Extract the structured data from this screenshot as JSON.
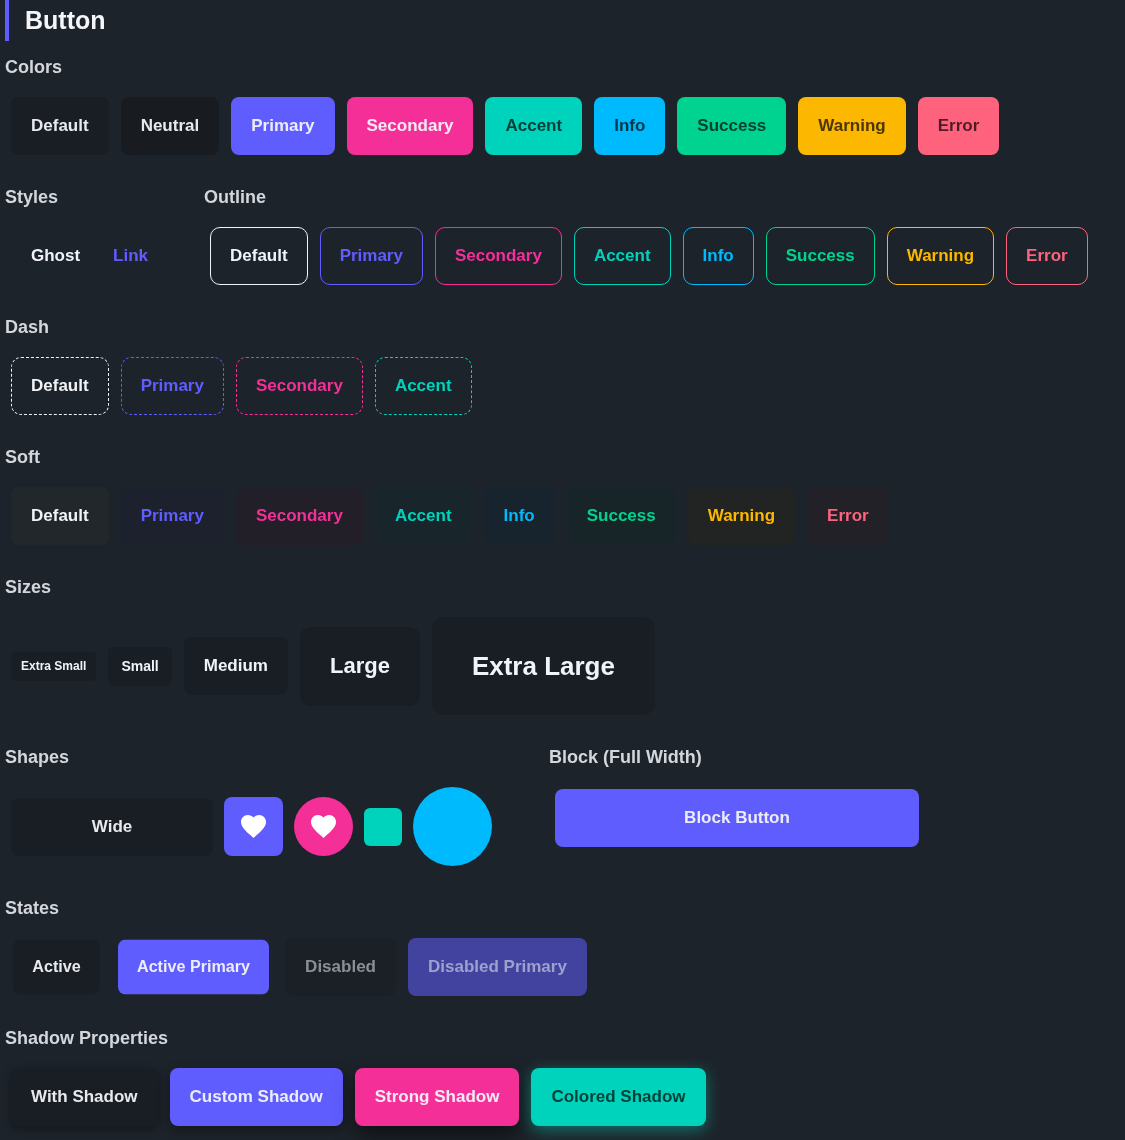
{
  "title": "Button",
  "colors": {
    "heading": "Colors",
    "buttons": [
      {
        "label": "Default",
        "color": "#191e24"
      },
      {
        "label": "Neutral",
        "color": "#181b20"
      },
      {
        "label": "Primary",
        "color": "#605dff"
      },
      {
        "label": "Secondary",
        "color": "#f43098"
      },
      {
        "label": "Accent",
        "color": "#00d3bb"
      },
      {
        "label": "Info",
        "color": "#00bafe"
      },
      {
        "label": "Success",
        "color": "#00d390"
      },
      {
        "label": "Warning",
        "color": "#fcb700"
      },
      {
        "label": "Error",
        "color": "#ff627d"
      }
    ]
  },
  "styles": {
    "heading": "Styles",
    "buttons": [
      {
        "label": "Ghost",
        "kind": "ghost"
      },
      {
        "label": "Link",
        "kind": "link"
      }
    ]
  },
  "outline": {
    "heading": "Outline",
    "buttons": [
      {
        "label": "Default",
        "color": "#f0f3f7"
      },
      {
        "label": "Primary",
        "color": "#605dff"
      },
      {
        "label": "Secondary",
        "color": "#f43098"
      },
      {
        "label": "Accent",
        "color": "#00d3bb"
      },
      {
        "label": "Info",
        "color": "#00bafe"
      },
      {
        "label": "Success",
        "color": "#00d390"
      },
      {
        "label": "Warning",
        "color": "#fcb700"
      },
      {
        "label": "Error",
        "color": "#ff627d"
      }
    ]
  },
  "dash": {
    "heading": "Dash",
    "buttons": [
      {
        "label": "Default",
        "color": "#f0f3f7"
      },
      {
        "label": "Primary",
        "color": "#605dff"
      },
      {
        "label": "Secondary",
        "color": "#f43098"
      },
      {
        "label": "Accent",
        "color": "#00d3bb"
      }
    ]
  },
  "soft": {
    "heading": "Soft",
    "buttons": [
      {
        "label": "Default",
        "color": "#f0f3f7"
      },
      {
        "label": "Primary",
        "color": "#605dff"
      },
      {
        "label": "Secondary",
        "color": "#f43098"
      },
      {
        "label": "Accent",
        "color": "#00d3bb"
      },
      {
        "label": "Info",
        "color": "#00bafe"
      },
      {
        "label": "Success",
        "color": "#00d390"
      },
      {
        "label": "Warning",
        "color": "#fcb700"
      },
      {
        "label": "Error",
        "color": "#ff627d"
      }
    ]
  },
  "sizes": {
    "heading": "Sizes",
    "buttons": [
      {
        "label": "Extra Small",
        "kind": "xsmall"
      },
      {
        "label": "Small",
        "kind": "small"
      },
      {
        "label": "Medium",
        "kind": "medium"
      },
      {
        "label": "Large",
        "kind": "large"
      },
      {
        "label": "Extra Large",
        "kind": "xlarge"
      }
    ]
  },
  "shapes": {
    "heading": "Shapes",
    "buttons": [
      {
        "kind": "wide",
        "label": "Wide",
        "color": "#191e24"
      },
      {
        "kind": "squareicon",
        "color": "#605dff"
      },
      {
        "kind": "circleicon",
        "color": "#f43098"
      },
      {
        "kind": "square",
        "color": "#00d3bb"
      },
      {
        "kind": "circle",
        "color": "#00bafe"
      }
    ]
  },
  "block": {
    "heading": "Block (Full Width)",
    "button": {
      "label": "Block Button",
      "color": "#605dff"
    }
  },
  "states": {
    "heading": "States",
    "buttons": [
      {
        "label": "Active",
        "color": "#191e24",
        "active": true,
        "disabled": false
      },
      {
        "label": "Active Primary",
        "color": "#605dff",
        "active": true,
        "disabled": false
      },
      {
        "label": "Disabled",
        "color": "#1b2027",
        "active": false,
        "disabled": true
      },
      {
        "label": "Disabled Primary",
        "color": "#42439f",
        "active": false,
        "disabled": true
      }
    ]
  },
  "shadows": {
    "heading": "Shadow Properties",
    "buttons": [
      {
        "label": "With Shadow",
        "color": "#191e24",
        "kind": "plain"
      },
      {
        "label": "Custom Shadow",
        "color": "#605dff",
        "kind": "custom"
      },
      {
        "label": "Strong Shadow",
        "color": "#f43098",
        "kind": "strong"
      },
      {
        "label": "Colored Shadow",
        "color": "#00d3bb",
        "kind": "colored"
      }
    ]
  }
}
